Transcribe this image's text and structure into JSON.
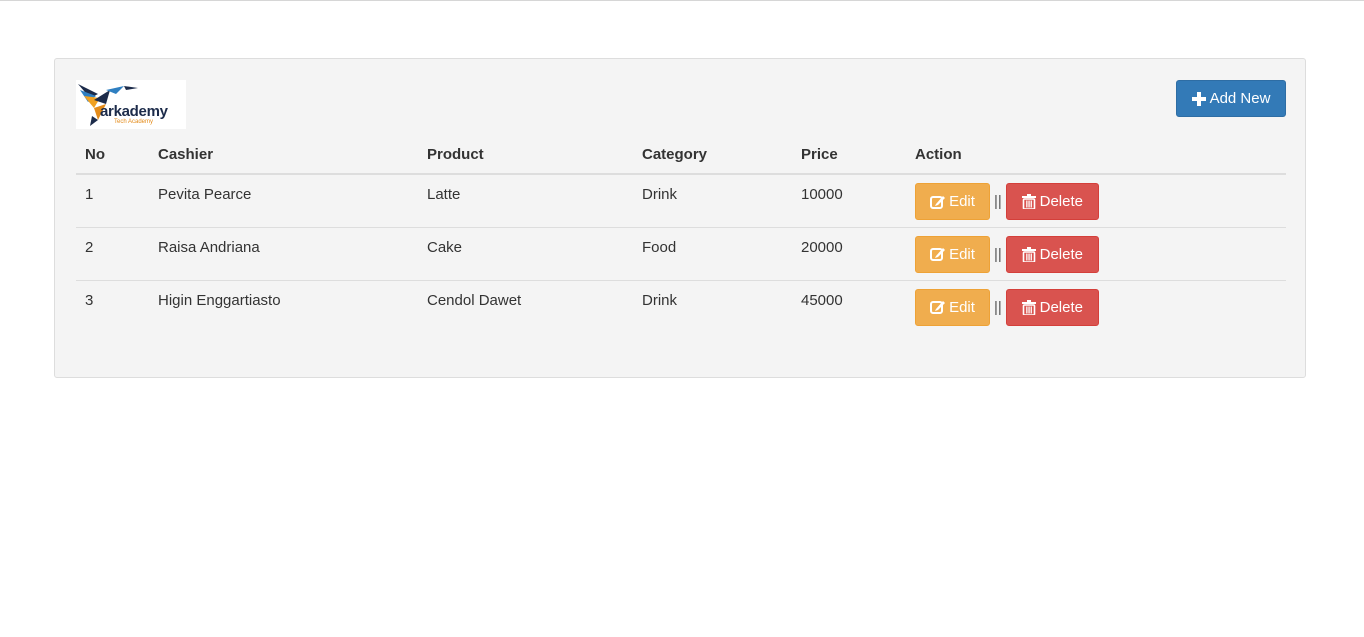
{
  "logo": {
    "word": "arkademy",
    "tagline": "Tech Academy"
  },
  "toolbar": {
    "add_label": "Add New"
  },
  "table": {
    "headers": [
      "No",
      "Cashier",
      "Product",
      "Category",
      "Price",
      "Action"
    ],
    "rows": [
      {
        "no": "1",
        "cashier": "Pevita Pearce",
        "product": "Latte",
        "category": "Drink",
        "price": "10000"
      },
      {
        "no": "2",
        "cashier": "Raisa Andriana",
        "product": "Cake",
        "category": "Food",
        "price": "20000"
      },
      {
        "no": "3",
        "cashier": "Higin Enggartiasto",
        "product": "Cendol Dawet",
        "category": "Drink",
        "price": "45000"
      }
    ],
    "edit_label": "Edit",
    "delete_label": "Delete",
    "separator": "||"
  },
  "colors": {
    "primary": "#337ab7",
    "warning": "#f0ad4e",
    "danger": "#d9534f",
    "panel_bg": "#f4f4f4"
  },
  "icons": {
    "add": "plus-icon",
    "edit": "edit-icon",
    "delete": "trash-icon"
  }
}
